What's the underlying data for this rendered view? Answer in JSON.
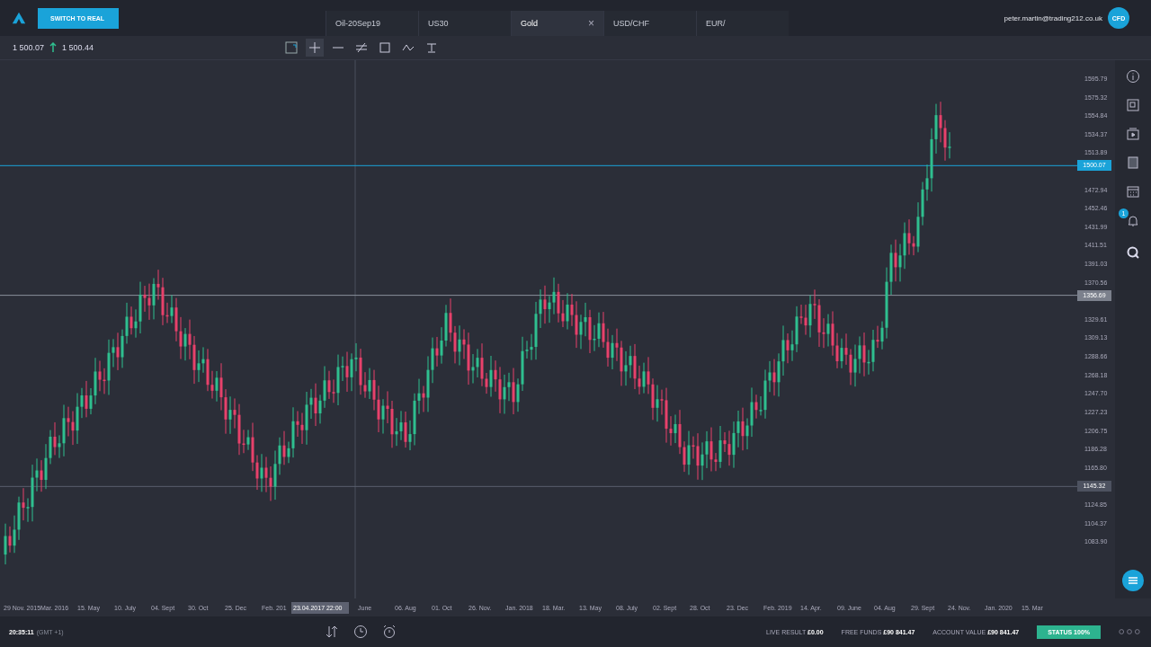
{
  "header": {
    "switch_button": "SWITCH TO REAL",
    "tabs": [
      {
        "label": "Oil-20Sep19",
        "selected": false
      },
      {
        "label": "US30",
        "selected": false
      },
      {
        "label": "Gold",
        "selected": true,
        "close": "×"
      },
      {
        "label": "USD/CHF",
        "selected": false
      },
      {
        "label": "EUR/",
        "selected": false
      }
    ],
    "user_email": "peter.martin@trading212.co.uk",
    "avatar": "CFD"
  },
  "quote": {
    "sell": "1 500.07",
    "buy": "1 500.44"
  },
  "price_axis": {
    "labels": [
      "1595.79",
      "1575.32",
      "1554.84",
      "1534.37",
      "1513.89",
      "1472.94",
      "1452.46",
      "1431.99",
      "1411.51",
      "1391.03",
      "1370.56",
      "1329.61",
      "1309.13",
      "1288.66",
      "1268.18",
      "1247.70",
      "1227.23",
      "1206.75",
      "1186.28",
      "1165.80",
      "1124.85",
      "1104.37",
      "1083.90"
    ],
    "markers": [
      {
        "kind": "current",
        "label": "1500.07"
      },
      {
        "kind": "line",
        "label": "1356.69"
      },
      {
        "kind": "level",
        "label": "1145.32"
      }
    ]
  },
  "time_axis": [
    {
      "kind": "tick",
      "label": "29 Nov. 2015"
    },
    {
      "kind": "tick",
      "label": "Mar. 2016"
    },
    {
      "kind": "tick",
      "label": "15. May"
    },
    {
      "kind": "tick",
      "label": "10. July"
    },
    {
      "kind": "tick",
      "label": "04. Sept"
    },
    {
      "kind": "tick",
      "label": "30. Oct"
    },
    {
      "kind": "tick",
      "label": "25. Dec"
    },
    {
      "kind": "tick",
      "label": "Feb. 201"
    },
    {
      "kind": "cursor",
      "label": "23.04.2017 22:00"
    },
    {
      "kind": "tick",
      "label": "June"
    },
    {
      "kind": "tick",
      "label": "06. Aug"
    },
    {
      "kind": "tick",
      "label": "01. Oct"
    },
    {
      "kind": "tick",
      "label": "26. Nov."
    },
    {
      "kind": "tick",
      "label": "Jan. 2018"
    },
    {
      "kind": "tick",
      "label": "18. Mar."
    },
    {
      "kind": "tick",
      "label": "13. May"
    },
    {
      "kind": "tick",
      "label": "08. July"
    },
    {
      "kind": "tick",
      "label": "02. Sept"
    },
    {
      "kind": "tick",
      "label": "28. Oct"
    },
    {
      "kind": "tick",
      "label": "23. Dec"
    },
    {
      "kind": "tick",
      "label": "Feb. 2019"
    },
    {
      "kind": "tick",
      "label": "14. Apr."
    },
    {
      "kind": "tick",
      "label": "09. June"
    },
    {
      "kind": "tick",
      "label": "04. Aug"
    },
    {
      "kind": "tick",
      "label": "29. Sept"
    },
    {
      "kind": "tick",
      "label": "24. Nov."
    },
    {
      "kind": "tick",
      "label": "Jan. 2020"
    },
    {
      "kind": "tick",
      "label": "15. Mar"
    }
  ],
  "sidebar": {
    "notification_badge": "1"
  },
  "footer": {
    "time": "20:35:11",
    "timezone": "(GMT +1)",
    "stats": [
      {
        "label": "LIVE RESULT",
        "value": "£0.00"
      },
      {
        "label": "FREE FUNDS",
        "value": "£90 841.47"
      },
      {
        "label": "ACCOUNT VALUE",
        "value": "£90 841.47"
      }
    ],
    "status": "STATUS 100%"
  }
}
